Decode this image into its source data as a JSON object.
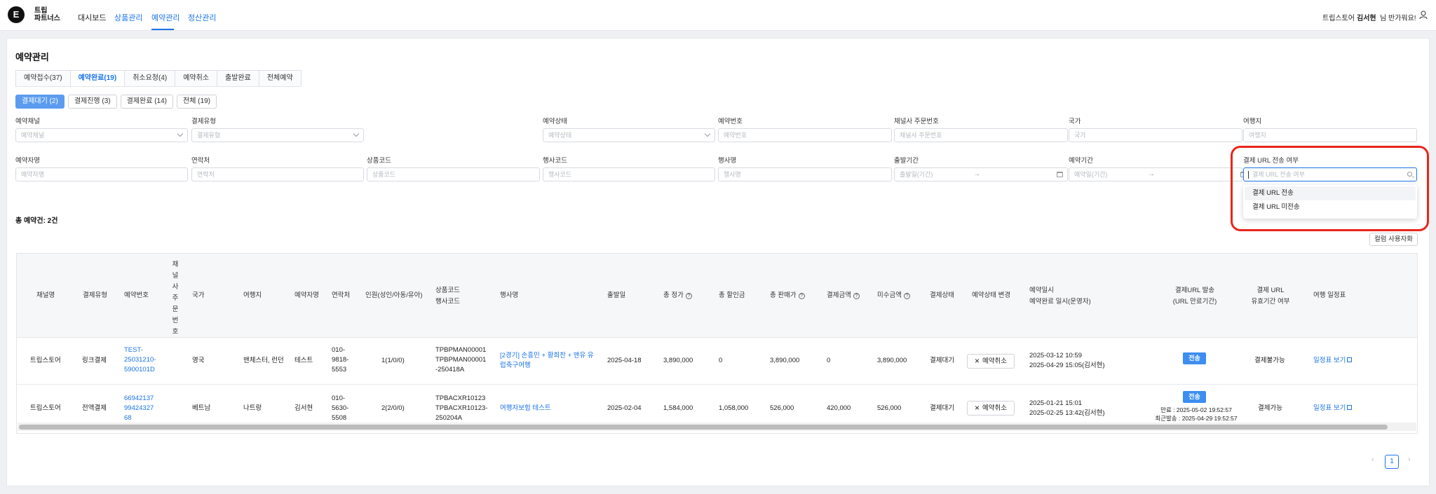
{
  "header": {
    "logo_letter": "E",
    "brand_line1": "트립",
    "brand_line2": "파트너스",
    "nav": [
      "대시보드",
      "상품관리",
      "예약관리",
      "정산관리"
    ],
    "company": "트립스토어",
    "user_name": "김서현",
    "greeting": "님 반가워요!",
    "icons": {
      "user": "user-icon"
    }
  },
  "page": {
    "title": "예약관리",
    "tabs": [
      "예약접수(37)",
      "예약완료(19)",
      "취소요청(4)",
      "예약취소",
      "출발완료",
      "전체예약"
    ],
    "subtabs": [
      "결제대기 (2)",
      "결제진행 (3)",
      "결제완료 (14)",
      "전체 (19)"
    ]
  },
  "filters": {
    "row1": [
      {
        "label": "예약채널",
        "placeholder": "예약채널"
      },
      {
        "label": "결제유형",
        "placeholder": "결제유형"
      },
      {
        "label": "예약상태",
        "placeholder": "예약상태"
      },
      {
        "label": "예약번호",
        "placeholder": "예약번호"
      },
      {
        "label": "채널사 주문번호",
        "placeholder": "채널사 주문번호"
      },
      {
        "label": "국가",
        "placeholder": "국가"
      },
      {
        "label": "여행지",
        "placeholder": "여행지"
      }
    ],
    "row2": [
      {
        "label": "예약자명",
        "placeholder": "예약자명"
      },
      {
        "label": "연락처",
        "placeholder": "연락처"
      },
      {
        "label": "상품코드",
        "placeholder": "상품코드"
      },
      {
        "label": "행사코드",
        "placeholder": "행사코드"
      },
      {
        "label": "행사명",
        "placeholder": "행사명"
      },
      {
        "label": "출발기간",
        "placeholder": "출발일(기간)"
      },
      {
        "label": "예약기간",
        "placeholder": "예약일(기간)"
      },
      {
        "label": "결제 URL 전송 여부",
        "placeholder": "결제 URL 전송 여부"
      }
    ],
    "range_arrow": "→",
    "dropdown_options": [
      "결제 URL 전송",
      "결제 URL 미전송"
    ]
  },
  "summary": {
    "count_label": "총 예약건: 2건",
    "column_button": "컬럼 사용자화"
  },
  "table": {
    "headers": {
      "channel": "채널명",
      "pay_type": "결제유형",
      "res_no": "예약번호",
      "channel_order": "채널사주문번호",
      "country": "국가",
      "dest": "여행지",
      "name": "예약자명",
      "phone": "연락처",
      "pax": "인원(성인/아동/유아)",
      "code1": "상품코드",
      "code2": "행사코드",
      "event": "행사명",
      "depart": "출발일",
      "total_price": "총 정가",
      "discount": "총 할인금",
      "sale": "총 판매가",
      "paid": "결제금액",
      "unpaid": "미수금액",
      "pay_status": "결제상태",
      "change": "예약상태 변경",
      "date1": "예약일시",
      "date2": "예약완료 일시(운영자)",
      "url_send1": "결제URL 발송",
      "url_send2": "(URL 만료기간)",
      "url_valid1": "결제 URL",
      "url_valid2": "유효기간 여부",
      "itinerary": "여행 일정표"
    },
    "rows": [
      {
        "channel": "트립스토어",
        "pay_type": "링크결제",
        "res_no": [
          "TEST-",
          "25031210-",
          "5900101D"
        ],
        "country": "영국",
        "dest": "맨체스터, 런던",
        "name": "테스트",
        "phone": [
          "010-",
          "9818-",
          "5553"
        ],
        "pax": "1(1/0/0)",
        "codes": [
          "TPBPMAN00001",
          "TPBPMAN00001",
          "-250418A"
        ],
        "event": [
          "[2경기] 손흥민 + 황희찬 + 맨유 유",
          "럽축구여행"
        ],
        "depart": "2025-04-18",
        "total_price": "3,890,000",
        "discount": "0",
        "sale": "3,890,000",
        "paid": "0",
        "unpaid": "3,890,000",
        "pay_status": "결제대기",
        "cancel": "예약취소",
        "dates": [
          "2025-03-12 10:59",
          "2025-04-29 15:05(김서현)"
        ],
        "badge": "전송",
        "url_info": [],
        "url_valid": "결제불가능",
        "itinerary": "일정표 보기"
      },
      {
        "channel": "트립스토어",
        "pay_type": "전액결제",
        "res_no": [
          "66942137",
          "99424327",
          "68"
        ],
        "country": "베트남",
        "dest": "나트랑",
        "name": "김서현",
        "phone": [
          "010-",
          "5630-",
          "5508"
        ],
        "pax": "2(2/0/0)",
        "codes": [
          "TPBACXR10123",
          "TPBACXR10123-",
          "250204A"
        ],
        "event": [
          "여행자보험 테스트"
        ],
        "depart": "2025-02-04",
        "total_price": "1,584,000",
        "discount": "1,058,000",
        "sale": "526,000",
        "paid": "420,000",
        "unpaid": "526,000",
        "pay_status": "결제대기",
        "cancel": "예약취소",
        "dates": [
          "2025-01-21 15:01",
          "2025-02-25 13:42(김서현)"
        ],
        "badge": "전송",
        "url_info": [
          "만료 : 2025-05-02 19:52:57",
          "최근발송 : 2025-04-29 19:52:57"
        ],
        "url_valid": "결제가능",
        "itinerary": "일정표 보기"
      }
    ]
  },
  "pagination": {
    "current": "1",
    "prev": "‹",
    "next": "›"
  },
  "colors": {
    "accent": "#1a73e8",
    "highlight_border": "#e8261b",
    "active_subtab": "#5b9cf0"
  }
}
